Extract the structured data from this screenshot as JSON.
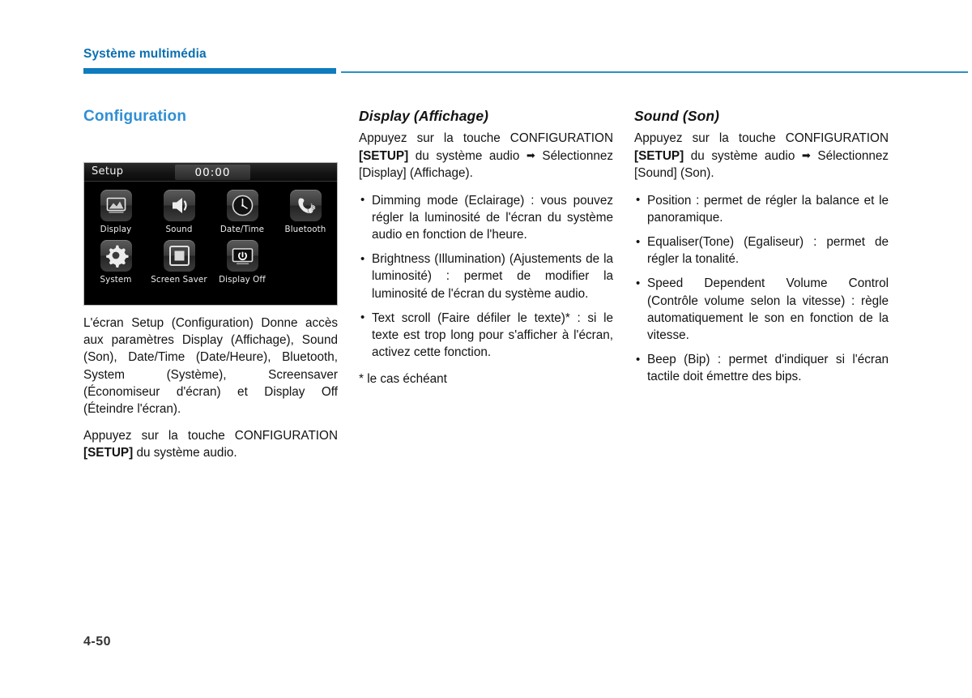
{
  "header": {
    "running_title": "Système multimédia",
    "rule_color": "#0e7cbd"
  },
  "page_number": "4-50",
  "left_column": {
    "heading": "Configuration",
    "paragraph_1": "L'écran Setup (Configuration) Donne accès aux paramètres Display (Affichage), Sound (Son), Date/Time (Date/Heure), Bluetooth, System (Système), Screensaver (Économiseur d'écran) et Display Off (Éteindre l'écran).",
    "paragraph_2_part1": "Appuyez sur la touche CONFIGURATION ",
    "paragraph_2_bold": "[SETUP]",
    "paragraph_2_part2": " du système audio."
  },
  "device_screenshot": {
    "title": "Setup",
    "clock": "00:00",
    "row_1": [
      {
        "label": "Display",
        "icon": "picture-icon"
      },
      {
        "label": "Sound",
        "icon": "speaker-icon"
      },
      {
        "label": "Date/Time",
        "icon": "clock-icon"
      },
      {
        "label": "Bluetooth",
        "icon": "bluetooth-phone-icon"
      }
    ],
    "row_2": [
      {
        "label": "System",
        "icon": "gear-icon"
      },
      {
        "label": "Screen Saver",
        "icon": "screensaver-icon"
      },
      {
        "label": "Display Off",
        "icon": "power-display-icon"
      }
    ]
  },
  "middle_column": {
    "heading": "Display (Affichage)",
    "intro_part1": "Appuyez sur la touche CONFIGURATION ",
    "intro_bold": "[SETUP]",
    "intro_part2": " du système audio ",
    "intro_arrow": "➡",
    "intro_part3": " Sélectionnez [Display] (Affichage).",
    "bullets": [
      "Dimming mode (Eclairage) : vous pouvez régler la luminosité de l'écran du système audio en fonction de l'heure.",
      "Brightness (Illumination) (Ajustements de la luminosité) : permet de modifier la luminosité de l'écran du système audio.",
      "Text scroll (Faire défiler le texte)* : si le texte est trop long pour s'afficher à l'écran, activez cette fonction."
    ],
    "footnote": "* le cas échéant"
  },
  "right_column": {
    "heading": "Sound (Son)",
    "intro_part1": "Appuyez sur la touche CONFIGURATION ",
    "intro_bold": "[SETUP]",
    "intro_part2": " du système audio ",
    "intro_arrow": "➡",
    "intro_part3": " Sélectionnez [Sound] (Son).",
    "bullets": [
      "Position : permet de régler la balance et le panoramique.",
      "Equaliser(Tone) (Egaliseur) : permet de régler la tonalité.",
      "Speed Dependent Volume Control (Contrôle volume selon la vitesse) : règle automatiquement le son en fonction de la vitesse.",
      "Beep (Bip) :  permet d'indiquer si l'écran tactile doit émettre des bips."
    ]
  }
}
